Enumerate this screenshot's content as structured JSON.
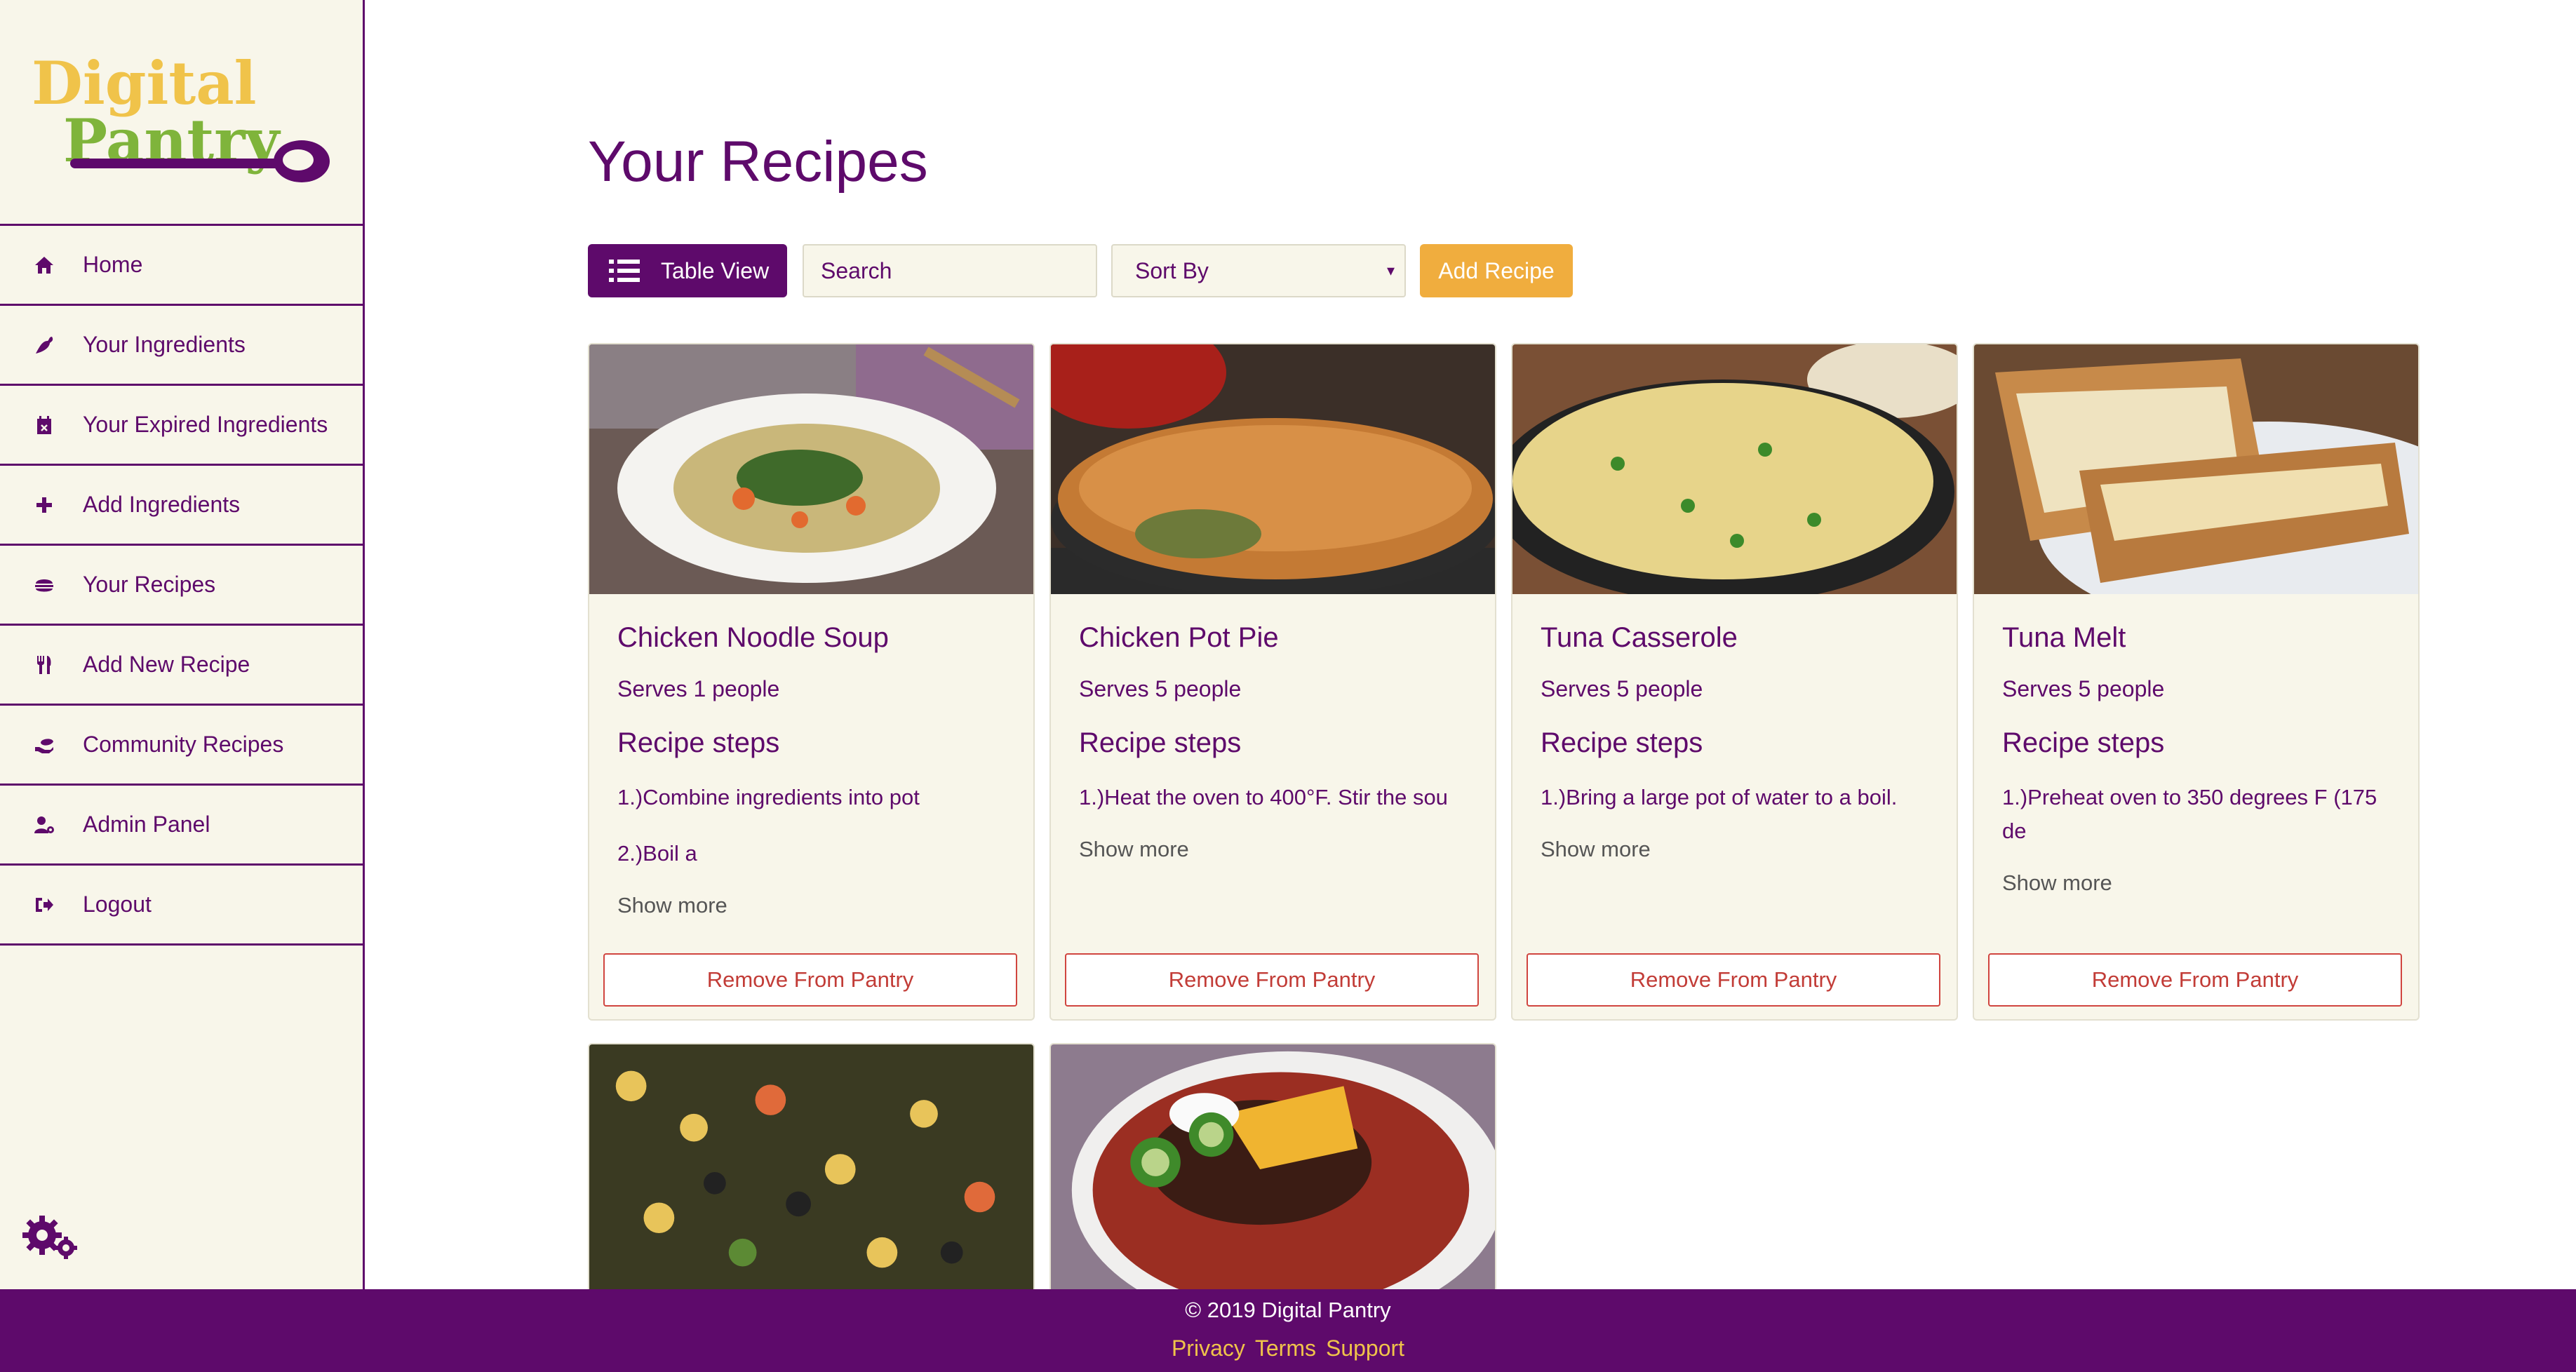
{
  "brand": {
    "logo_line1": "Digital",
    "logo_line2": "Pantry"
  },
  "colors": {
    "primary": "#5e0a6b",
    "accent": "#f0ad3e",
    "sidebar_bg": "#f8f6ea",
    "danger": "#c23c37",
    "logo_yellow": "#f0c34a",
    "logo_green": "#7fb43b"
  },
  "sidebar": {
    "items": [
      {
        "label": "Home",
        "icon": "home-icon"
      },
      {
        "label": "Your Ingredients",
        "icon": "pepper-icon"
      },
      {
        "label": "Your Expired Ingredients",
        "icon": "calendar-x-icon"
      },
      {
        "label": "Add Ingredients",
        "icon": "plus-icon"
      },
      {
        "label": "Your Recipes",
        "icon": "burger-icon"
      },
      {
        "label": "Add New Recipe",
        "icon": "utensils-icon"
      },
      {
        "label": "Community Recipes",
        "icon": "hand-holding-icon"
      },
      {
        "label": "Admin Panel",
        "icon": "user-cog-icon"
      },
      {
        "label": "Logout",
        "icon": "sign-out-icon"
      }
    ],
    "settings_icon": "cogs-icon"
  },
  "main": {
    "title": "Your Recipes",
    "toolbar": {
      "table_view_label": "Table View",
      "search_placeholder": "Search",
      "sort_label": "Sort By",
      "add_recipe_label": "Add Recipe"
    },
    "cards": [
      {
        "title": "Chicken Noodle Soup",
        "serves": "Serves 1 people",
        "steps_heading": "Recipe steps",
        "steps": [
          "1.)Combine ingredients into pot",
          "2.)Boil a"
        ],
        "show_more": "Show more",
        "remove_label": "Remove From Pantry"
      },
      {
        "title": "Chicken Pot Pie",
        "serves": "Serves 5 people",
        "steps_heading": "Recipe steps",
        "steps": [
          "1.)Heat the oven to 400°F. Stir the sou"
        ],
        "show_more": "Show more",
        "remove_label": "Remove From Pantry"
      },
      {
        "title": "Tuna Casserole",
        "serves": "Serves 5 people",
        "steps_heading": "Recipe steps",
        "steps": [
          "1.)Bring a large pot of water to a boil."
        ],
        "show_more": "Show more",
        "remove_label": "Remove From Pantry"
      },
      {
        "title": "Tuna Melt",
        "serves": "Serves 5 people",
        "steps_heading": "Recipe steps",
        "steps": [
          "1.)Preheat oven to 350 degrees F (175 de"
        ],
        "show_more": "Show more",
        "remove_label": "Remove From Pantry"
      }
    ]
  },
  "footer": {
    "copyright": "© 2019 Digital Pantry",
    "links": [
      "Privacy",
      "Terms",
      "Support"
    ]
  }
}
